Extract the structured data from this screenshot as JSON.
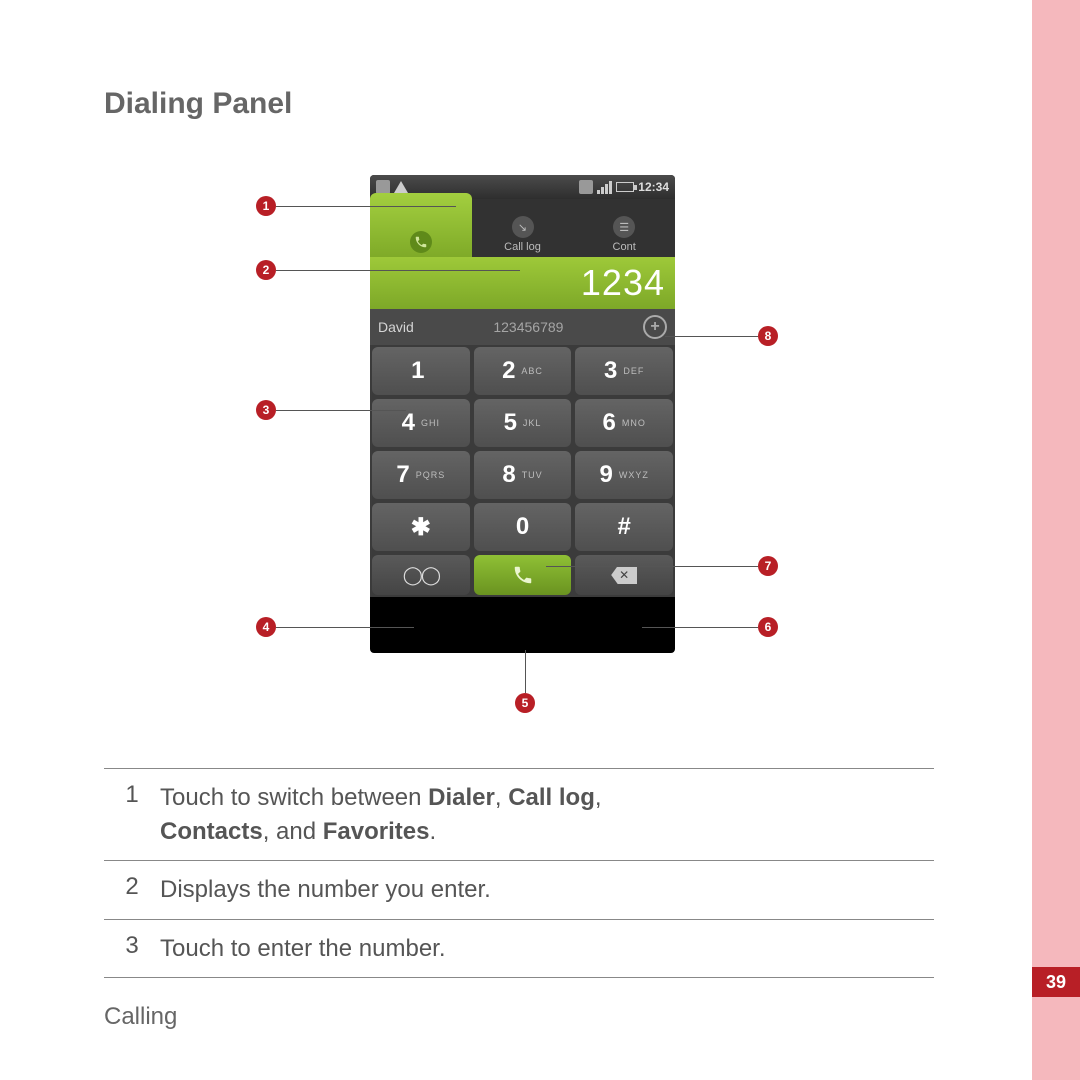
{
  "page": {
    "heading": "Dialing Panel",
    "footer": "Calling",
    "number": "39"
  },
  "phone": {
    "time": "12:34",
    "tabs": [
      "",
      "Call log",
      "Cont"
    ],
    "display": "1234",
    "suggest": {
      "name": "David",
      "number": "123456789"
    },
    "keys": [
      {
        "d": "1",
        "l": ""
      },
      {
        "d": "2",
        "l": "ABC"
      },
      {
        "d": "3",
        "l": "DEF"
      },
      {
        "d": "4",
        "l": "GHI"
      },
      {
        "d": "5",
        "l": "JKL"
      },
      {
        "d": "6",
        "l": "MNO"
      },
      {
        "d": "7",
        "l": "PQRS"
      },
      {
        "d": "8",
        "l": "TUV"
      },
      {
        "d": "9",
        "l": "WXYZ"
      },
      {
        "d": "✱",
        "l": ""
      },
      {
        "d": "0",
        "l": ""
      },
      {
        "d": "#",
        "l": ""
      }
    ]
  },
  "callouts": [
    "1",
    "2",
    "3",
    "4",
    "5",
    "6",
    "7",
    "8"
  ],
  "table": [
    {
      "n": "1",
      "t1": "Touch to switch between",
      "b1": "Dialer",
      "c1": ",",
      "b2": "Call log",
      "c2": ",",
      "b3": "Contacts",
      "c3": ", and",
      "b4": "Favorites",
      "t2": "."
    },
    {
      "n": "2",
      "text": "Displays the number you enter."
    },
    {
      "n": "3",
      "text": "Touch to enter the number."
    }
  ]
}
